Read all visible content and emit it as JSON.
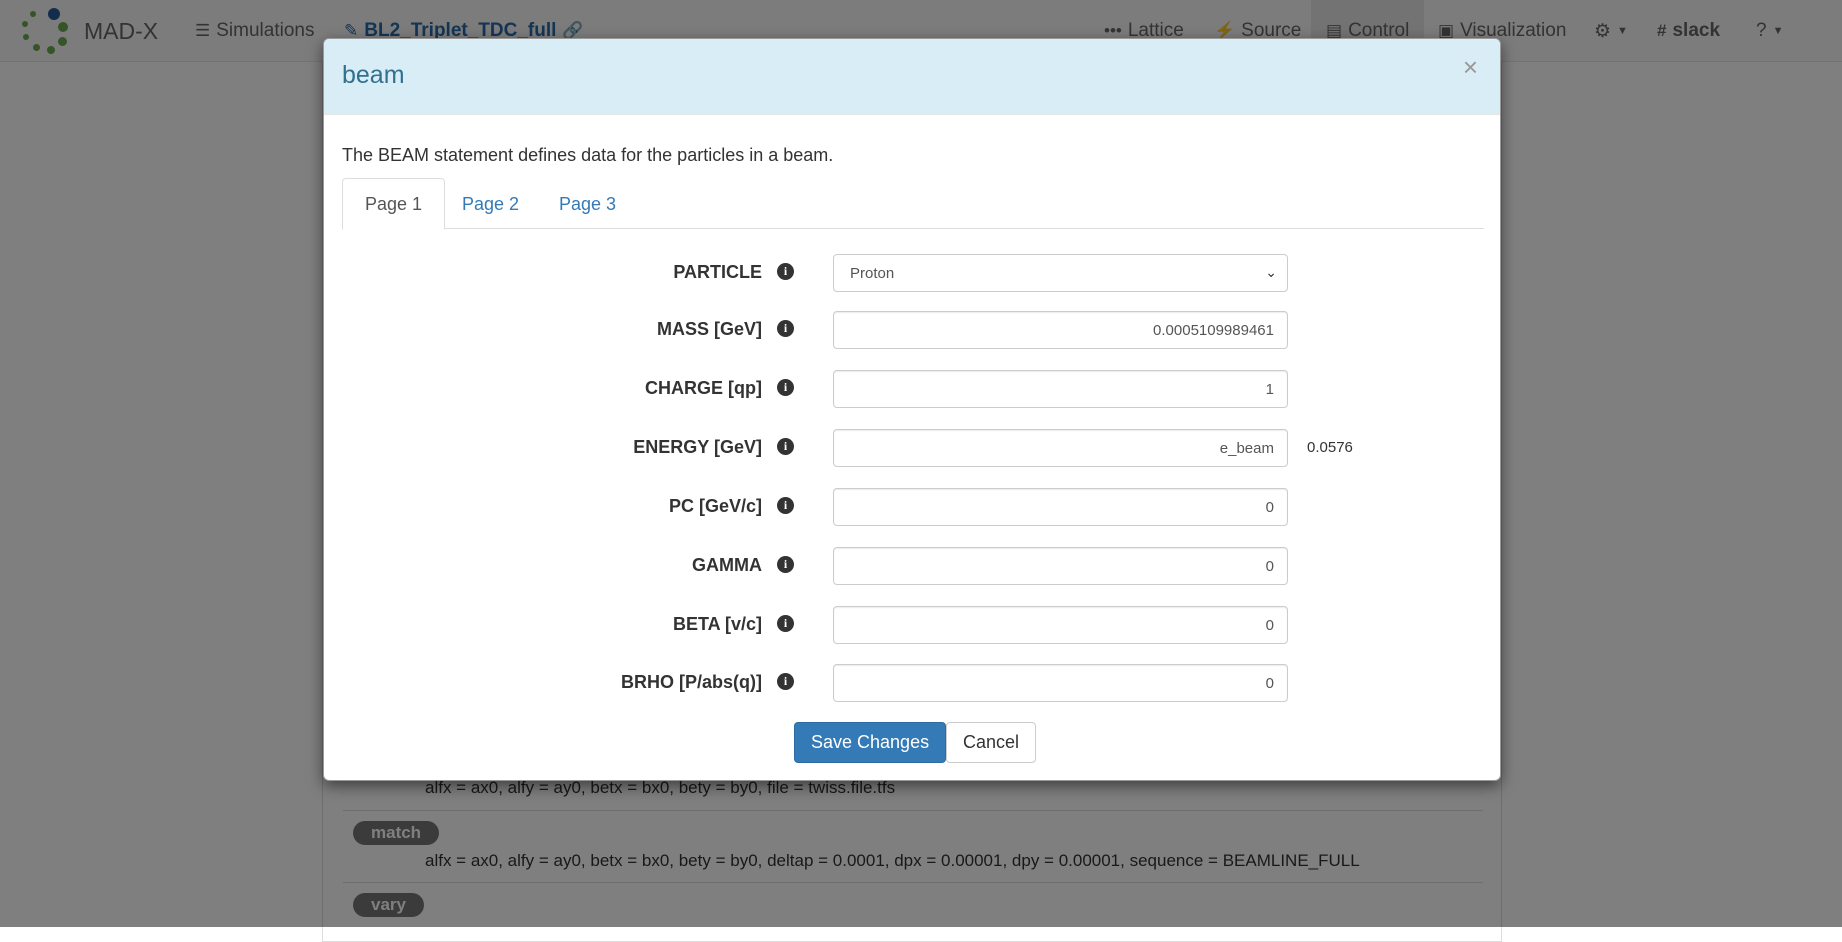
{
  "navbar": {
    "brand": "MAD-X",
    "simulations_label": "Simulations",
    "simulation_name": "BL2_Triplet_TDC_full",
    "lattice_label": "Lattice",
    "source_label": "Source",
    "control_label": "Control",
    "visualization_label": "Visualization",
    "slack_label": "slack"
  },
  "background_commands": [
    {
      "text": "alfx = ax0, alfy = ay0, betx = bx0, bety = by0, file = twiss.file.tfs"
    },
    {
      "name": "match",
      "text": "alfx = ax0, alfy = ay0, betx = bx0, bety = by0, deltap = 0.0001, dpx = 0.00001, dpy = 0.00001, sequence = BEAMLINE_FULL"
    },
    {
      "name": "vary",
      "text": ""
    }
  ],
  "modal": {
    "title": "beam",
    "close": "×",
    "description": "The BEAM statement defines data for the particles in a beam.",
    "tabs": [
      {
        "label": "Page 1",
        "active": true
      },
      {
        "label": "Page 2",
        "active": false
      },
      {
        "label": "Page 3",
        "active": false
      }
    ],
    "fields": [
      {
        "label": "PARTICLE",
        "type": "select",
        "value": "Proton"
      },
      {
        "label": "MASS [GeV]",
        "type": "input",
        "value": "0.0005109989461"
      },
      {
        "label": "CHARGE [qp]",
        "type": "input",
        "value": "1"
      },
      {
        "label": "ENERGY [GeV]",
        "type": "input",
        "value": "e_beam",
        "extra": "0.0576"
      },
      {
        "label": "PC [GeV/c]",
        "type": "input",
        "value": "0"
      },
      {
        "label": "GAMMA",
        "type": "input",
        "value": "0"
      },
      {
        "label": "BETA [v/c]",
        "type": "input",
        "value": "0"
      },
      {
        "label": "BRHO [P/abs(q)]",
        "type": "input",
        "value": "0"
      }
    ],
    "save_label": "Save Changes",
    "cancel_label": "Cancel"
  },
  "colors": {
    "header_bg": "#d9edf7",
    "title": "#31708f",
    "primary": "#337ab7",
    "backdrop": "rgba(0,0,0,0.5)"
  }
}
